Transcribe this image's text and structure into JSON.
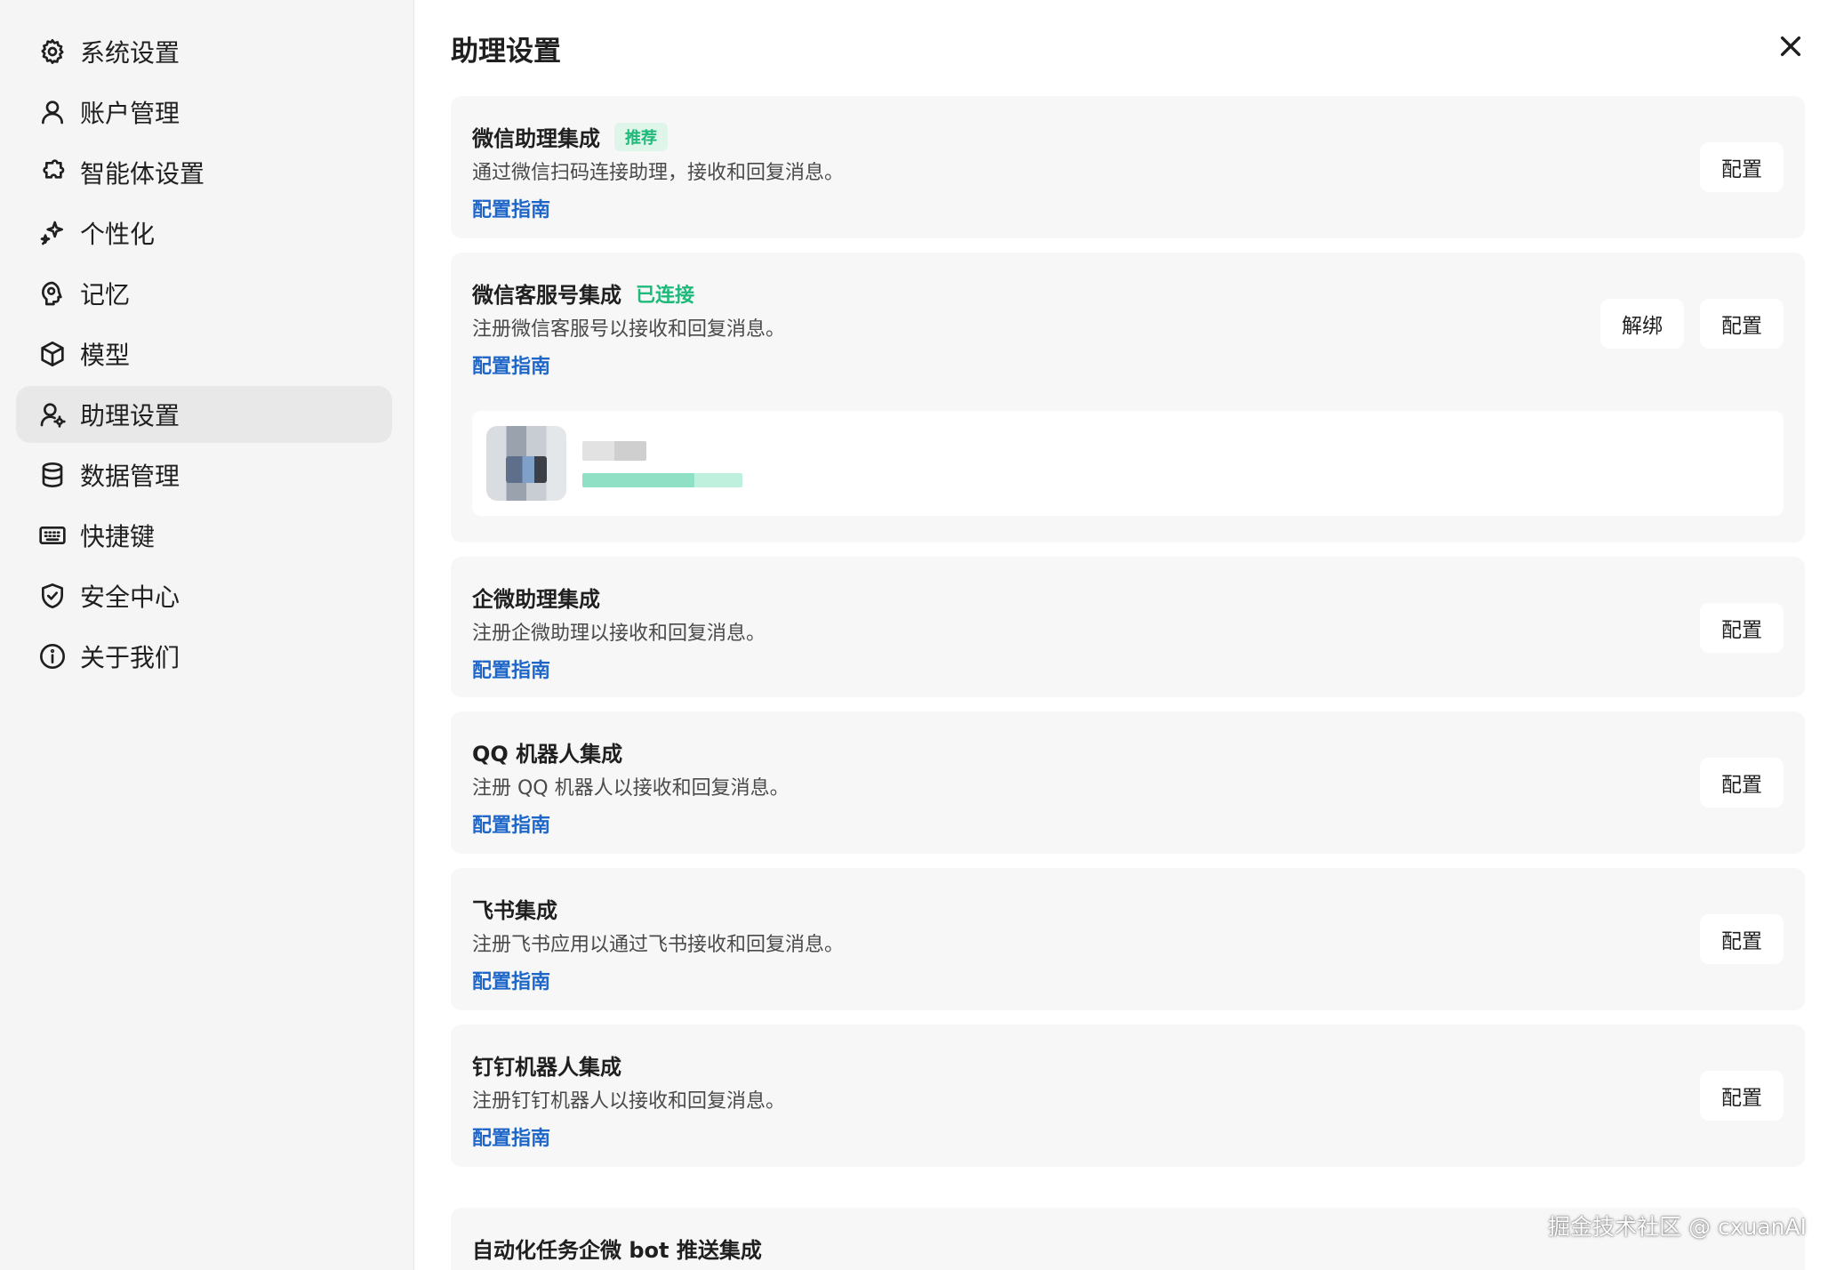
{
  "sidebar": {
    "items": [
      {
        "label": "系统设置",
        "icon": "gear-icon"
      },
      {
        "label": "账户管理",
        "icon": "user-icon"
      },
      {
        "label": "智能体设置",
        "icon": "puzzle-icon"
      },
      {
        "label": "个性化",
        "icon": "sparkle-icon"
      },
      {
        "label": "记忆",
        "icon": "brain-icon"
      },
      {
        "label": "模型",
        "icon": "cube-icon"
      },
      {
        "label": "助理设置",
        "icon": "user-gear-icon",
        "active": true
      },
      {
        "label": "数据管理",
        "icon": "database-icon"
      },
      {
        "label": "快捷键",
        "icon": "keyboard-icon"
      },
      {
        "label": "安全中心",
        "icon": "shield-icon"
      },
      {
        "label": "关于我们",
        "icon": "info-icon"
      }
    ]
  },
  "main": {
    "title": "助理设置",
    "integrations": [
      {
        "title": "微信助理集成",
        "badge": "推荐",
        "desc": "通过微信扫码连接助理，接收和回复消息。",
        "link": "配置指南",
        "configure": "配置"
      },
      {
        "title": "微信客服号集成",
        "status": "已连接",
        "desc": "注册微信客服号以接收和回复消息。",
        "link": "配置指南",
        "unbind": "解绑",
        "configure": "配置"
      },
      {
        "title": "企微助理集成",
        "desc": "注册企微助理以接收和回复消息。",
        "link": "配置指南",
        "configure": "配置"
      },
      {
        "title": "QQ 机器人集成",
        "desc": "注册 QQ 机器人以接收和回复消息。",
        "link": "配置指南",
        "configure": "配置"
      },
      {
        "title": "飞书集成",
        "desc": "注册飞书应用以通过飞书接收和回复消息。",
        "link": "配置指南",
        "configure": "配置"
      },
      {
        "title": "钉钉机器人集成",
        "desc": "注册钉钉机器人以接收和回复消息。",
        "link": "配置指南",
        "configure": "配置"
      },
      {
        "title": "自动化任务企微 bot 推送集成"
      }
    ]
  },
  "watermark": "掘金技术社区 @ cxuanAI",
  "colors": {
    "accent_link": "#1f66c9",
    "success": "#1fb97a",
    "sidebar_bg": "#f5f5f5",
    "card_bg": "#f7f7f7"
  }
}
